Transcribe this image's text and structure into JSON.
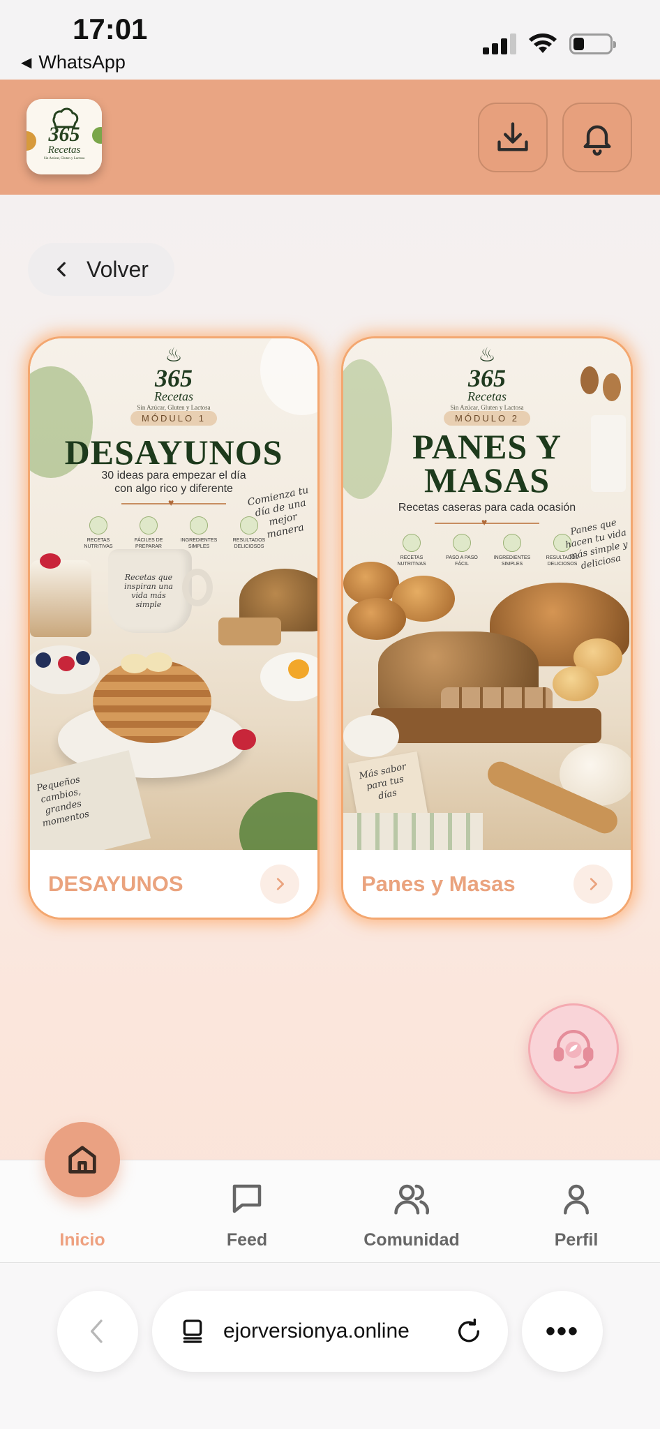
{
  "status_bar": {
    "time": "17:01",
    "back_app": "WhatsApp"
  },
  "header": {
    "logo": {
      "number": "365",
      "word": "Recetas",
      "tagline": "Sin Azúcar, Gluten y Lactosa"
    },
    "download_icon": "download-icon",
    "notifications_icon": "bell-icon"
  },
  "back_button": {
    "label": "Volver"
  },
  "modules": [
    {
      "cover": {
        "brand_number": "365",
        "brand_word": "Recetas",
        "brand_tagline": "Sin Azúcar, Gluten y Lactosa",
        "module_tag": "MÓDULO 1",
        "title": "DESAYUNOS",
        "subtitle_line1": "30 ideas para empezar el día",
        "subtitle_line2": "con algo rico y diferente",
        "features": [
          "RECETAS NUTRITIVAS",
          "FÁCILES DE PREPARAR",
          "INGREDIENTES SIMPLES",
          "RESULTADOS DELICIOSOS"
        ],
        "note_top": "Comienza tu día de una mejor manera",
        "note_mug": "Recetas que inspiran una vida más simple",
        "note_bottom": "Pequeños cambios, grandes momentos"
      },
      "label": "DESAYUNOS"
    },
    {
      "cover": {
        "brand_number": "365",
        "brand_word": "Recetas",
        "brand_tagline": "Sin Azúcar, Gluten y Lactosa",
        "module_tag": "MÓDULO 2",
        "title_line1": "PANES Y",
        "title_line2": "MASAS",
        "subtitle": "Recetas caseras para cada ocasión",
        "features": [
          "RECETAS NUTRITIVAS",
          "PASO A PASO FÁCIL",
          "INGREDIENTES SIMPLES",
          "RESULTADOS DELICIOSOS"
        ],
        "note_top": "Panes que hacen tu vida más simple y deliciosa",
        "note_bottom": "Más sabor para tus días"
      },
      "label": "Panes y Masas"
    }
  ],
  "support_button": {
    "icon": "headset-support-icon"
  },
  "bottom_nav": [
    {
      "label": "Inicio",
      "icon": "home-icon",
      "active": true
    },
    {
      "label": "Feed",
      "icon": "chat-bubble-icon",
      "active": false
    },
    {
      "label": "Comunidad",
      "icon": "users-icon",
      "active": false
    },
    {
      "label": "Perfil",
      "icon": "user-icon",
      "active": false
    }
  ],
  "browser": {
    "url": "ejorversionya.online"
  },
  "colors": {
    "header_bg": "#e9a583",
    "accent": "#eaa37e",
    "card_glow": "#f3a770",
    "title_green": "#1d3a1c"
  }
}
